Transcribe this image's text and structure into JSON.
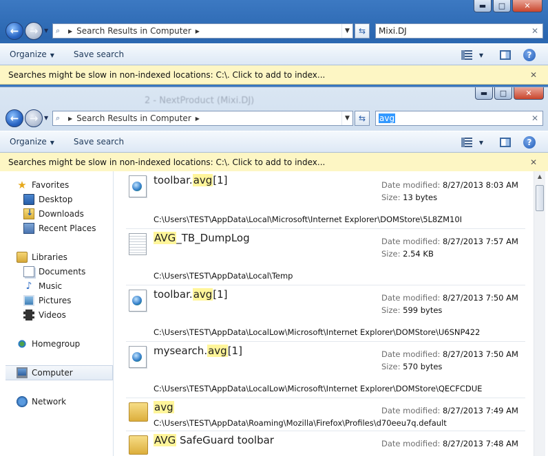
{
  "back_window": {
    "caption_buttons": {
      "minimize": "▬",
      "maximize": "□",
      "close": "✕"
    },
    "breadcrumb": "Search Results in Computer",
    "search_value": "Mixi.DJ",
    "toolbar": {
      "organize": "Organize",
      "save_search": "Save search"
    },
    "infobar": "Searches might be slow in non-indexed locations: C:\\. Click to add to index..."
  },
  "front_window": {
    "caption_buttons": {
      "minimize": "▬",
      "maximize": "□",
      "close": "✕"
    },
    "ghost_text": "2 - NextProduct (Mixi.DJ)",
    "breadcrumb": "Search Results in Computer",
    "search_value": "avg",
    "toolbar": {
      "organize": "Organize",
      "save_search": "Save search"
    },
    "infobar": "Searches might be slow in non-indexed locations: C:\\. Click to add to index...",
    "nav": {
      "favorites": "Favorites",
      "desktop": "Desktop",
      "downloads": "Downloads",
      "recent_places": "Recent Places",
      "libraries": "Libraries",
      "documents": "Documents",
      "music": "Music",
      "pictures": "Pictures",
      "videos": "Videos",
      "homegroup": "Homegroup",
      "computer": "Computer",
      "network": "Network"
    },
    "results_labels": {
      "date_modified": "Date modified:",
      "size": "Size:"
    },
    "results": [
      {
        "pre": "toolbar.",
        "hl": "avg",
        "post": "[1]",
        "date": "8/27/2013 8:03 AM",
        "size": "13 bytes",
        "path": "C:\\Users\\TEST\\AppData\\Local\\Microsoft\\Internet Explorer\\DOMStore\\5L8ZM10I"
      },
      {
        "pre": "",
        "hl": "AVG",
        "post": "_TB_DumpLog",
        "date": "8/27/2013 7:57 AM",
        "size": "2.54 KB",
        "path": "C:\\Users\\TEST\\AppData\\Local\\Temp"
      },
      {
        "pre": "toolbar.",
        "hl": "avg",
        "post": "[1]",
        "date": "8/27/2013 7:50 AM",
        "size": "599 bytes",
        "path": "C:\\Users\\TEST\\AppData\\LocalLow\\Microsoft\\Internet Explorer\\DOMStore\\U6SNP422"
      },
      {
        "pre": "mysearch.",
        "hl": "avg",
        "post": "[1]",
        "date": "8/27/2013 7:50 AM",
        "size": "570 bytes",
        "path": "C:\\Users\\TEST\\AppData\\LocalLow\\Microsoft\\Internet Explorer\\DOMStore\\QECFCDUE"
      },
      {
        "pre": "",
        "hl": "avg",
        "post": "",
        "date": "8/27/2013 7:49 AM",
        "path": "C:\\Users\\TEST\\AppData\\Roaming\\Mozilla\\Firefox\\Profiles\\d70eeu7q.default"
      },
      {
        "pre": "",
        "hl": "AVG",
        "post": " SafeGuard toolbar",
        "date": "8/27/2013 7:48 AM"
      }
    ]
  }
}
